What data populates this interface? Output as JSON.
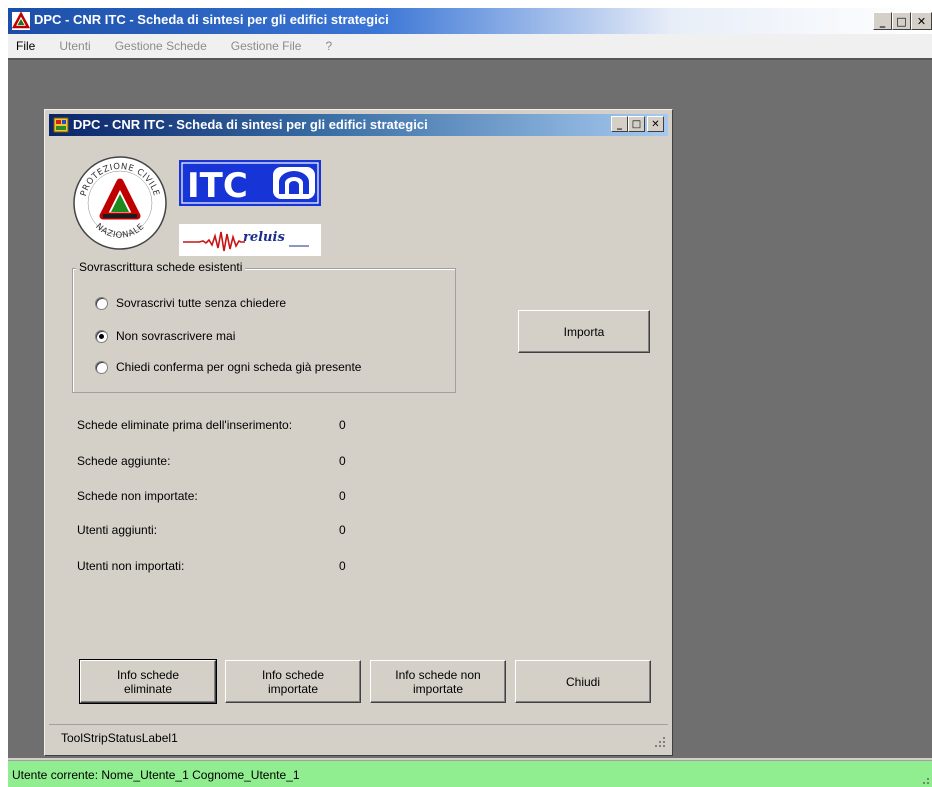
{
  "app": {
    "title": "DPC - CNR ITC - Scheda di sintesi per gli edifici strategici",
    "icon": "dpc-triangle-icon",
    "controls": {
      "minimize": "_",
      "maximize": "□",
      "close": "✕"
    }
  },
  "menu": {
    "items": [
      {
        "label": "File",
        "enabled": true
      },
      {
        "label": "Utenti",
        "enabled": false
      },
      {
        "label": "Gestione Schede",
        "enabled": false
      },
      {
        "label": "Gestione File",
        "enabled": false
      },
      {
        "label": "?",
        "enabled": false
      }
    ]
  },
  "child": {
    "title": "DPC - CNR ITC - Scheda di sintesi per gli edifici strategici",
    "icon": "form-icon",
    "logos": {
      "dpc": {
        "text_top": "PROTEZIONE CIVILE",
        "text_bottom": "NAZIONALE"
      },
      "itc": "ITC",
      "reluis": "reluis"
    },
    "group": {
      "legend": "Sovrascrittura schede esistenti",
      "options": [
        {
          "label": "Sovrascrivi tutte senza chiedere",
          "checked": false
        },
        {
          "label": "Non sovrascrivere mai",
          "checked": true
        },
        {
          "label": "Chiedi conferma per ogni scheda già presente",
          "checked": false
        }
      ]
    },
    "import_button": "Importa",
    "stats": [
      {
        "label": "Schede eliminate prima dell'inserimento:",
        "value": "0"
      },
      {
        "label": "Schede aggiunte:",
        "value": "0"
      },
      {
        "label": "Schede non importate:",
        "value": "0"
      },
      {
        "label": "Utenti aggiunti:",
        "value": "0"
      },
      {
        "label": "Utenti non importati:",
        "value": "0"
      }
    ],
    "buttons": {
      "info_eliminate": [
        "Info schede",
        "eliminate"
      ],
      "info_importate": [
        "Info schede",
        "importate"
      ],
      "info_non_importate": [
        "Info schede non",
        "importate"
      ],
      "chiudi": "Chiudi"
    },
    "status": "ToolStripStatusLabel1"
  },
  "status_bar": {
    "text": "Utente corrente: Nome_Utente_1 Cognome_Utente_1",
    "color": "#90ee90"
  }
}
